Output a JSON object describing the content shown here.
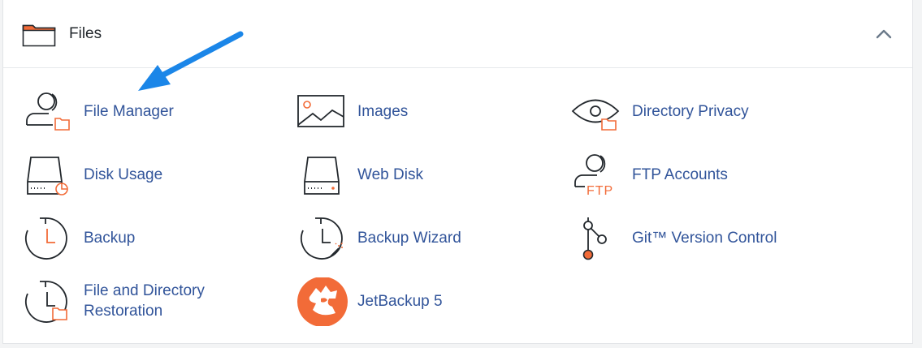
{
  "section": {
    "title": "Files",
    "header_icon": "folder-icon",
    "collapse_icon": "chevron-up-icon"
  },
  "colors": {
    "link": "#31549a",
    "accent": "#f26b38",
    "arrow": "#1b86e8"
  },
  "items": [
    {
      "label": "File Manager",
      "icon": "file-manager-icon"
    },
    {
      "label": "Images",
      "icon": "images-icon"
    },
    {
      "label": "Directory Privacy",
      "icon": "directory-privacy-icon"
    },
    {
      "label": "Disk Usage",
      "icon": "disk-usage-icon"
    },
    {
      "label": "Web Disk",
      "icon": "web-disk-icon"
    },
    {
      "label": "FTP Accounts",
      "icon": "ftp-accounts-icon",
      "icon_text": "FTP"
    },
    {
      "label": "Backup",
      "icon": "backup-icon"
    },
    {
      "label": "Backup Wizard",
      "icon": "backup-wizard-icon"
    },
    {
      "label": "Git™ Version Control",
      "icon": "git-icon"
    },
    {
      "label": "File and Directory Restoration",
      "icon": "restoration-icon"
    },
    {
      "label": "JetBackup 5",
      "icon": "jetbackup-icon"
    }
  ]
}
